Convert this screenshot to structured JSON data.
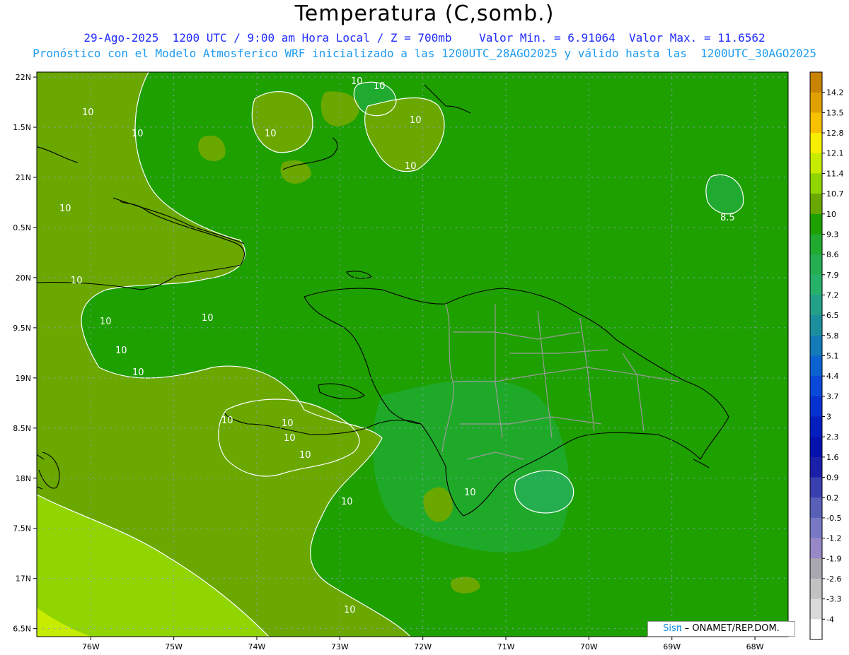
{
  "header": {
    "title": "Temperatura (C,somb.)",
    "line1": "29-Ago-2025  1200 UTC / 9:00 am Hora Local / Z = 700mb    Valor Min. = 6.91064  Valor Max. = 11.6562",
    "line2": "Pronóstico con el Modelo Atmosferico WRF inicializado a las 1200UTC_28AGO2025 y válido hasta las  1200UTC_30AGO2025"
  },
  "axes": {
    "lon_labels": [
      "76W",
      "75W",
      "74W",
      "73W",
      "72W",
      "71W",
      "70W",
      "69W",
      "68W"
    ],
    "lat_labels": [
      "22N",
      "1.5N",
      "21N",
      "0.5N",
      "20N",
      "9.5N",
      "19N",
      "8.5N",
      "18N",
      "7.5N",
      "17N",
      "6.5N"
    ],
    "lon_range": [
      -76.65,
      -67.6
    ],
    "lat_range": [
      16.42,
      22.05
    ]
  },
  "colorbar": {
    "labels": [
      "14.2",
      "13.5",
      "12.8",
      "12.1",
      "11.4",
      "10.7",
      "10",
      "9.3",
      "8.6",
      "7.9",
      "7.2",
      "6.5",
      "5.8",
      "5.1",
      "4.4",
      "3.7",
      "3",
      "2.3",
      "1.6",
      "0.9",
      "0.2",
      "-0.5",
      "-1.2",
      "-1.9",
      "-2.6",
      "-3.3",
      "-4"
    ],
    "colors": [
      "#c88400",
      "#e0a000",
      "#f7c000",
      "#f8ee00",
      "#c8ec00",
      "#90d400",
      "#6aa800",
      "#1ea000",
      "#20aa30",
      "#24ae50",
      "#26b16a",
      "#23a088",
      "#1b8f9e",
      "#147bb8",
      "#0d62d2",
      "#0a48d8",
      "#0632d0",
      "#041ec0",
      "#0612b0",
      "#1a20a8",
      "#3a40b0",
      "#5860b8",
      "#7878c4",
      "#9888c8",
      "#a8a8b0",
      "#c2c2c2",
      "#dadada",
      "#ffffff"
    ]
  },
  "contour_labels": [
    "10",
    "10",
    "10",
    "10",
    "10",
    "10",
    "10",
    "10",
    "10",
    "10",
    "10",
    "10",
    "10",
    "10",
    "10",
    "10",
    "10",
    "10",
    "10",
    "10",
    "8.5"
  ],
  "credit": {
    "brand": "Sisπ",
    "text": "– ONAMET/REP.DOM."
  },
  "colors": {
    "field_base": "#1ea000",
    "field_mid": "#6aa800",
    "field_warm": "#90d400",
    "field_cool": "#26b16a",
    "coast": "#000000",
    "province_border": "#9a9a9a",
    "grid": "#8aa0b8"
  }
}
